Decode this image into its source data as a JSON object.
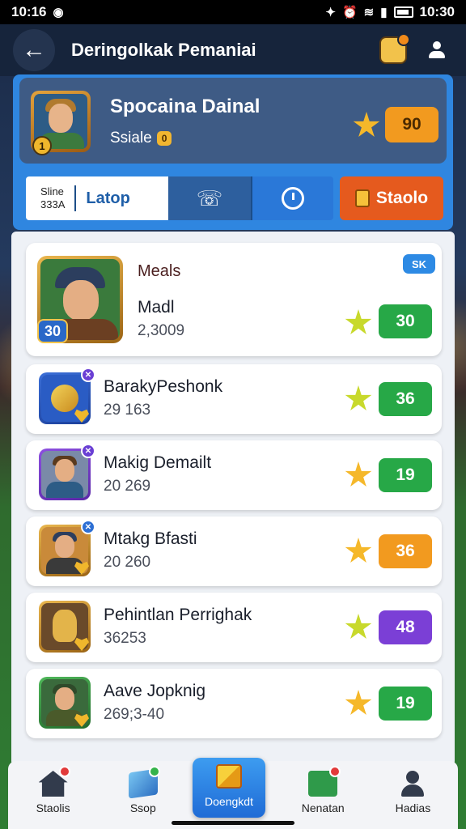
{
  "status_bar": {
    "time_left": "10:16",
    "time_right": "10:30"
  },
  "header": {
    "title": "Deringolkak Pemaniai"
  },
  "profile": {
    "name": "Spocaina Dainal",
    "subtitle": "Ssiale",
    "level_badge": "0",
    "score": "90",
    "level": "1"
  },
  "tabs": {
    "stacked_line1": "Sline",
    "stacked_line2": "333A",
    "active_label": "Latop",
    "action_button": "Staolo"
  },
  "featured": {
    "category": "Meals",
    "name": "Madl",
    "score": "2,3009",
    "level": "30",
    "value": "30",
    "corner_tag": "SK"
  },
  "rows": [
    {
      "name": "BarakyPeshonk",
      "score": "29 163",
      "value": "36",
      "star": "lime",
      "pill": "green"
    },
    {
      "name": "Makig Demailt",
      "score": "20 269",
      "value": "19",
      "star": "gold",
      "pill": "green"
    },
    {
      "name": "Mtakg Bfasti",
      "score": "20 260",
      "value": "36",
      "star": "gold",
      "pill": "orange"
    },
    {
      "name": "Pehintlan Perrighak",
      "score": "36253",
      "value": "48",
      "star": "lime",
      "pill": "purple"
    },
    {
      "name": "Aave Jopknig",
      "score": "269;3-40",
      "value": "19",
      "star": "gold",
      "pill": "green"
    }
  ],
  "bottom_nav": {
    "items": [
      "Staolis",
      "Ssop",
      "Doengkdt",
      "Nenatan",
      "Hadias"
    ]
  },
  "colors": {
    "accent_blue": "#2f86e0",
    "orange": "#f29a1f",
    "green": "#27a847",
    "purple": "#7b3fd6"
  }
}
